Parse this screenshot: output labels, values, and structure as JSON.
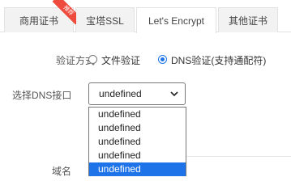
{
  "tabs": [
    {
      "label": "商用证书",
      "active": false,
      "badge": "推荐"
    },
    {
      "label": "宝塔SSL",
      "active": false
    },
    {
      "label": "Let's Encrypt",
      "active": true
    },
    {
      "label": "其他证书",
      "active": false
    }
  ],
  "form": {
    "verify_label": "验证方式",
    "verify_options": [
      {
        "label": "文件验证",
        "checked": false
      },
      {
        "label": "DNS验证(支持通配符)",
        "checked": true
      }
    ],
    "dns_label": "选择DNS接口",
    "dns_select_value": "undefined",
    "dns_options": [
      "undefined",
      "undefined",
      "undefined",
      "undefined",
      "undefined"
    ],
    "dns_selected_index": 4,
    "domain_label": "域名"
  },
  "colors": {
    "accent": "#1e73e8",
    "badge": "#ef4a3e"
  }
}
